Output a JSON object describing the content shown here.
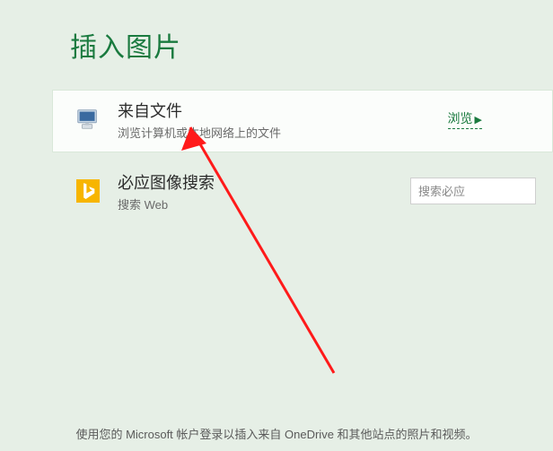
{
  "title": "插入图片",
  "options": {
    "from_file": {
      "title": "来自文件",
      "subtitle": "浏览计算机或本地网络上的文件",
      "action": "浏览"
    },
    "bing": {
      "title": "必应图像搜索",
      "subtitle": "搜索 Web",
      "placeholder": "搜索必应"
    }
  },
  "footer": "使用您的 Microsoft 帐户登录以插入来自 OneDrive 和其他站点的照片和视频。"
}
